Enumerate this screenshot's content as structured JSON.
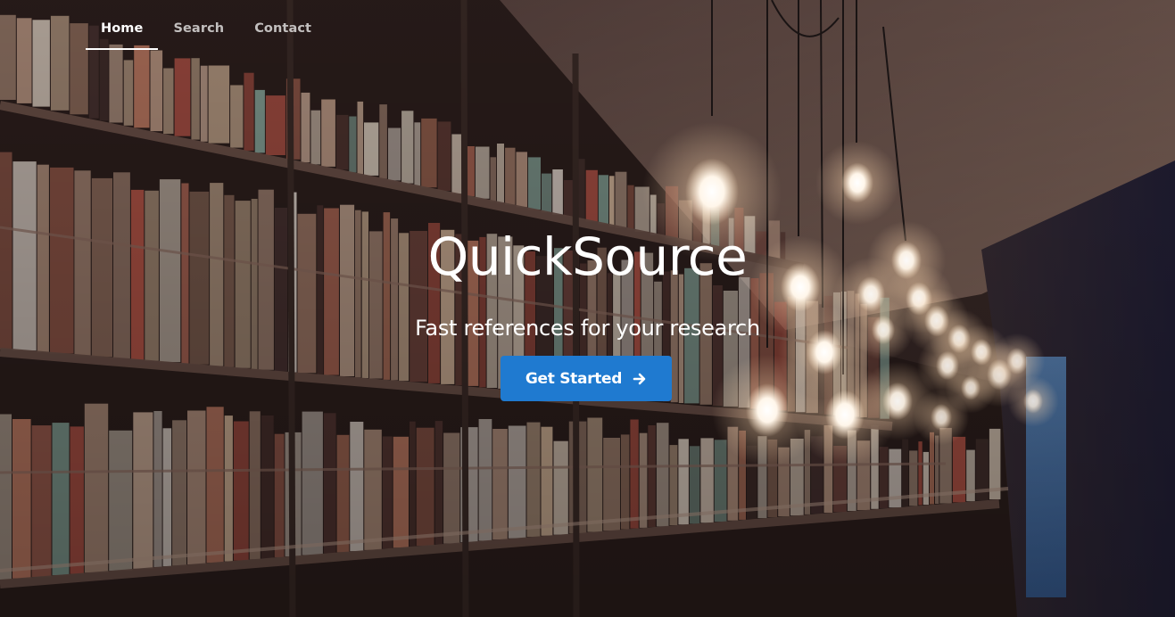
{
  "nav": {
    "items": [
      {
        "label": "Home",
        "active": true
      },
      {
        "label": "Search",
        "active": false
      },
      {
        "label": "Contact",
        "active": false
      }
    ]
  },
  "hero": {
    "title": "QuickSource",
    "subtitle": "Fast references for your research",
    "cta_label": "Get Started",
    "cta_icon": "arrow-right-icon",
    "background": "library-bookshelves-with-hanging-bulbs-photo"
  },
  "colors": {
    "cta_bg": "#1f7ad0",
    "text": "#ffffff",
    "nav_inactive": "#c8c2c0"
  }
}
